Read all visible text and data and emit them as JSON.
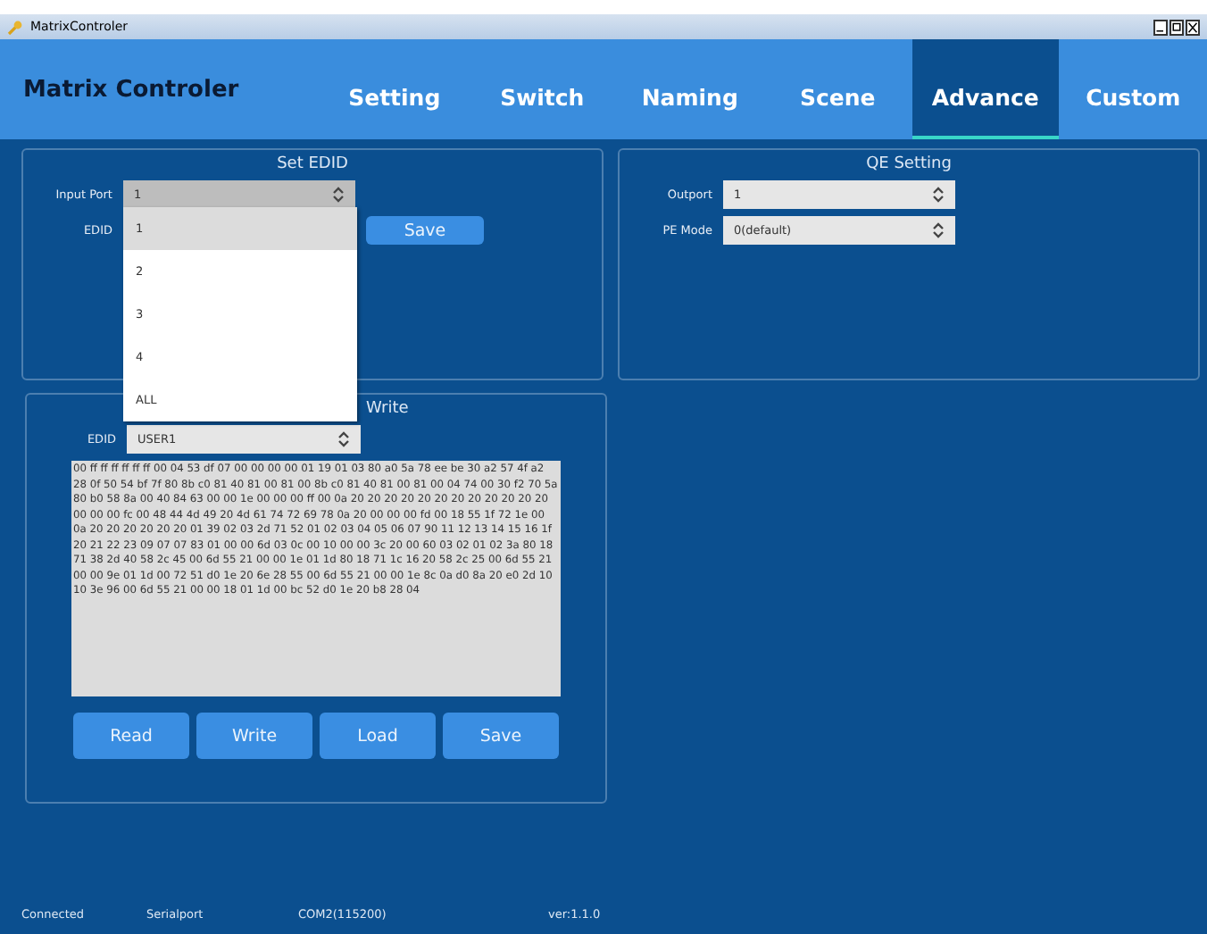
{
  "window": {
    "title": "MatrixControler"
  },
  "app_title": "Matrix Controler",
  "tabs": [
    {
      "label": "Setting",
      "selected": false
    },
    {
      "label": "Switch",
      "selected": false
    },
    {
      "label": "Naming",
      "selected": false
    },
    {
      "label": "Scene",
      "selected": false
    },
    {
      "label": "Advance",
      "selected": true
    },
    {
      "label": "Custom",
      "selected": false
    }
  ],
  "set_edid": {
    "title": "Set EDID",
    "input_port_label": "Input Port",
    "input_port_value": "1",
    "edid_label": "EDID",
    "save_button": "Save",
    "dropdown": [
      {
        "label": "1",
        "selected": true
      },
      {
        "label": "2",
        "selected": false
      },
      {
        "label": "3",
        "selected": false
      },
      {
        "label": "4",
        "selected": false
      },
      {
        "label": "ALL",
        "selected": false
      }
    ]
  },
  "qe_setting": {
    "title": "QE Setting",
    "outport_label": "Outport",
    "outport_value": "1",
    "pe_mode_label": "PE Mode",
    "pe_mode_value": "0(default)"
  },
  "edid_rw": {
    "title": "Write",
    "edid_label": "EDID",
    "edid_value": "USER1",
    "data": "00 ff ff ff ff ff ff 00 04 53 df 07 00 00 00 00 01 19 01 03 80 a0 5a 78 ee be 30 a2 57 4f a2 28 0f 50 54 bf 7f 80 8b c0 81 40 81 00 81 00 8b c0 81 40 81 00 81 00 04 74 00 30 f2 70 5a 80 b0 58 8a 00 40 84 63 00 00 1e 00 00 00 ff 00 0a 20 20 20 20 20 20 20 20 20 20 20 20 00 00 00 fc 00 48 44 4d 49 20 4d 61 74 72 69 78 0a 20 00 00 00 fd 00 18 55 1f 72 1e 00 0a 20 20 20 20 20 20 01 39 02 03 2d 71 52 01 02 03 04 05 06 07 90 11 12 13 14 15 16 1f 20 21 22 23 09 07 07 83 01 00 00 6d 03 0c 00 10 00 00 3c 20 00 60 03 02 01 02 3a 80 18 71 38 2d 40 58 2c 45 00 6d 55 21 00 00 1e 01 1d 80 18 71 1c 16 20 58 2c 25 00 6d 55 21 00 00 9e 01 1d 00 72 51 d0 1e 20 6e 28 55 00 6d 55 21 00 00 1e 8c 0a d0 8a 20 e0 2d 10 10 3e 96 00 6d 55 21 00 00 18 01 1d 00 bc 52 d0 1e 20 b8 28 04",
    "buttons": [
      "Read",
      "Write",
      "Load",
      "Save"
    ]
  },
  "status_bar": [
    "Connected",
    "Serialport",
    "COM2(115200)",
    "ver:1.1.0"
  ]
}
